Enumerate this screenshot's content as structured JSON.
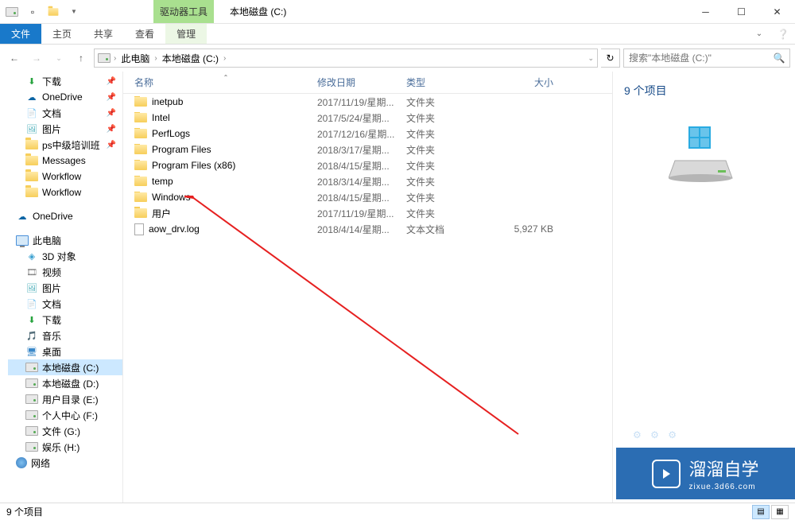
{
  "window": {
    "title": "本地磁盘 (C:)",
    "ribbon_context_label": "驱动器工具"
  },
  "ribbon": {
    "file": "文件",
    "home": "主页",
    "share": "共享",
    "view": "查看",
    "manage": "管理"
  },
  "breadcrumbs": {
    "root": "此电脑",
    "current": "本地磁盘 (C:)"
  },
  "search": {
    "placeholder": "搜索\"本地磁盘 (C:)\""
  },
  "sidebar": {
    "items": [
      {
        "label": "下载",
        "icon": "download",
        "pin": true,
        "level": 2
      },
      {
        "label": "OneDrive",
        "icon": "onedrive",
        "pin": true,
        "level": 2
      },
      {
        "label": "文档",
        "icon": "document",
        "pin": true,
        "level": 2
      },
      {
        "label": "图片",
        "icon": "picture",
        "pin": true,
        "level": 2
      },
      {
        "label": "ps中级培训班",
        "icon": "folder",
        "pin": true,
        "level": 2
      },
      {
        "label": "Messages",
        "icon": "folder",
        "pin": false,
        "level": 2
      },
      {
        "label": "Workflow",
        "icon": "folder",
        "pin": false,
        "level": 2
      },
      {
        "label": "Workflow",
        "icon": "folder",
        "pin": false,
        "level": 2
      }
    ],
    "onedrive": "OneDrive",
    "thispc": "此电脑",
    "pc_items": [
      {
        "label": "3D 对象",
        "icon": "3d"
      },
      {
        "label": "视频",
        "icon": "video"
      },
      {
        "label": "图片",
        "icon": "picture"
      },
      {
        "label": "文档",
        "icon": "document"
      },
      {
        "label": "下载",
        "icon": "download"
      },
      {
        "label": "音乐",
        "icon": "music"
      },
      {
        "label": "桌面",
        "icon": "desktop"
      },
      {
        "label": "本地磁盘 (C:)",
        "icon": "drive",
        "selected": true
      },
      {
        "label": "本地磁盘 (D:)",
        "icon": "drive"
      },
      {
        "label": "用户目录 (E:)",
        "icon": "drive"
      },
      {
        "label": "个人中心 (F:)",
        "icon": "drive"
      },
      {
        "label": "文件 (G:)",
        "icon": "drive"
      },
      {
        "label": "娱乐 (H:)",
        "icon": "drive"
      }
    ],
    "network": "网络"
  },
  "columns": {
    "name": "名称",
    "date": "修改日期",
    "type": "类型",
    "size": "大小"
  },
  "files": [
    {
      "name": "inetpub",
      "date": "2017/11/19/星期...",
      "type": "文件夹",
      "size": "",
      "icon": "folder"
    },
    {
      "name": "Intel",
      "date": "2017/5/24/星期...",
      "type": "文件夹",
      "size": "",
      "icon": "folder"
    },
    {
      "name": "PerfLogs",
      "date": "2017/12/16/星期...",
      "type": "文件夹",
      "size": "",
      "icon": "folder"
    },
    {
      "name": "Program Files",
      "date": "2018/3/17/星期...",
      "type": "文件夹",
      "size": "",
      "icon": "folder"
    },
    {
      "name": "Program Files (x86)",
      "date": "2018/4/15/星期...",
      "type": "文件夹",
      "size": "",
      "icon": "folder"
    },
    {
      "name": "temp",
      "date": "2018/3/14/星期...",
      "type": "文件夹",
      "size": "",
      "icon": "folder"
    },
    {
      "name": "Windows",
      "date": "2018/4/15/星期...",
      "type": "文件夹",
      "size": "",
      "icon": "folder"
    },
    {
      "name": "用户",
      "date": "2017/11/19/星期...",
      "type": "文件夹",
      "size": "",
      "icon": "folder"
    },
    {
      "name": "aow_drv.log",
      "date": "2018/4/14/星期...",
      "type": "文本文档",
      "size": "5,927 KB",
      "icon": "file"
    }
  ],
  "preview": {
    "title": "9 个项目"
  },
  "statusbar": {
    "count": "9 个项目"
  },
  "watermark": {
    "brand": "溜溜自学",
    "url": "zixue.3d66.com"
  }
}
